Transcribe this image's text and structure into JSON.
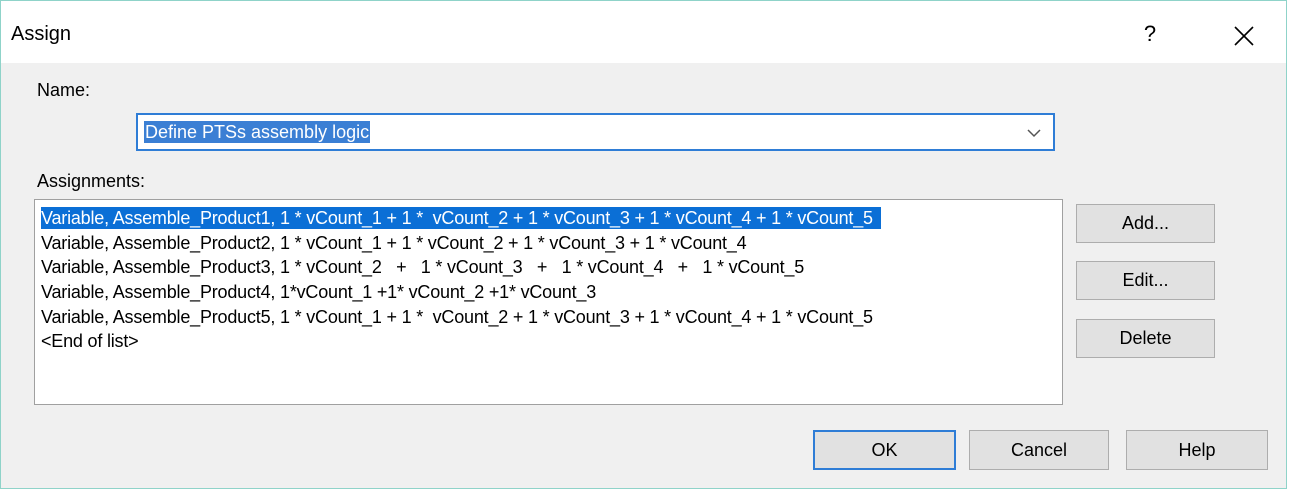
{
  "window": {
    "title": "Assign",
    "help_glyph": "?"
  },
  "name_field": {
    "label": "Name:",
    "value": "Define PTSs assembly logic"
  },
  "assignments": {
    "label": "Assignments:",
    "items": [
      "Variable, Assemble_Product1, 1 * vCount_1 + 1 *  vCount_2 + 1 * vCount_3 + 1 * vCount_4 + 1 * vCount_5",
      "Variable, Assemble_Product2, 1 * vCount_1 + 1 * vCount_2 + 1 * vCount_3 + 1 * vCount_4",
      "Variable, Assemble_Product3, 1 * vCount_2   +   1 * vCount_3   +   1 * vCount_4   +   1 * vCount_5",
      "Variable, Assemble_Product4, 1*vCount_1 +1* vCount_2 +1* vCount_3",
      "Variable, Assemble_Product5, 1 * vCount_1 + 1 *  vCount_2 + 1 * vCount_3 + 1 * vCount_4 + 1 * vCount_5",
      "<End of list>"
    ],
    "selected_index": 0
  },
  "side_buttons": {
    "add": "Add...",
    "edit": "Edit...",
    "delete": "Delete"
  },
  "footer_buttons": {
    "ok": "OK",
    "cancel": "Cancel",
    "help": "Help"
  },
  "colors": {
    "selection": "#0b6fd6",
    "focus_border": "#2f7dd6",
    "dialog_bg": "#f0f0f0"
  }
}
